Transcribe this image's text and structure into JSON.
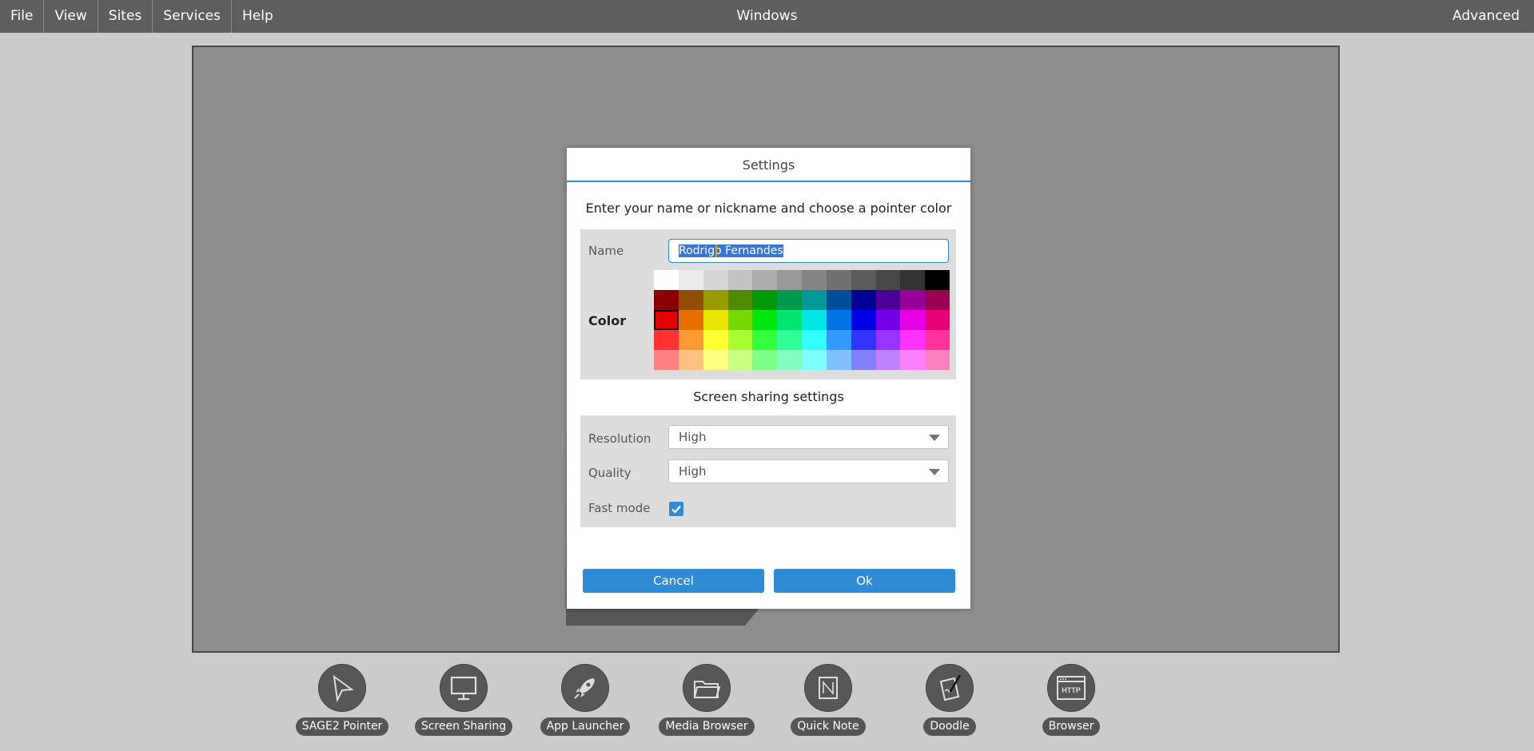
{
  "menubar": {
    "items": [
      "File",
      "View",
      "Sites",
      "Services",
      "Help"
    ],
    "center_title": "Windows",
    "right_item": "Advanced"
  },
  "dialog": {
    "title": "Settings",
    "subtitle": "Enter your name or nickname and choose a pointer color",
    "name_label": "Name",
    "name_value": "Rodrigo Fernandes",
    "color_label": "Color",
    "selected_color": "#e00000",
    "palette": [
      [
        "#ffffff",
        "#ebebeb",
        "#d6d6d6",
        "#c2c2c2",
        "#adadad",
        "#999999",
        "#858585",
        "#707070",
        "#5c5c5c",
        "#474747",
        "#333333",
        "#000000"
      ],
      [
        "#8b0000",
        "#934d0a",
        "#999900",
        "#4d8c00",
        "#00990a",
        "#00994d",
        "#009999",
        "#004d99",
        "#000099",
        "#4d0099",
        "#990099",
        "#990052"
      ],
      [
        "#e00000",
        "#e66f00",
        "#e6e600",
        "#73d900",
        "#00e60f",
        "#00e673",
        "#00e6e6",
        "#0073e6",
        "#0000e6",
        "#7300e6",
        "#e600e6",
        "#e6007a"
      ],
      [
        "#ff3333",
        "#ff9933",
        "#ffff33",
        "#a6ff33",
        "#33ff40",
        "#33ff99",
        "#33ffff",
        "#3399ff",
        "#3333ff",
        "#9933ff",
        "#ff33ff",
        "#ff3399"
      ],
      [
        "#ff8080",
        "#ffc080",
        "#ffff80",
        "#c8ff80",
        "#80ff88",
        "#80ffc0",
        "#80ffff",
        "#80c0ff",
        "#8080ff",
        "#c080ff",
        "#ff80ff",
        "#ff80c0"
      ]
    ],
    "share_title": "Screen sharing settings",
    "resolution_label": "Resolution",
    "resolution_value": "High",
    "quality_label": "Quality",
    "quality_value": "High",
    "fast_mode_label": "Fast mode",
    "fast_mode_checked": true,
    "cancel_label": "Cancel",
    "ok_label": "Ok"
  },
  "dock": [
    {
      "label": "SAGE2 Pointer",
      "icon": "pointer-arrow-icon"
    },
    {
      "label": "Screen Sharing",
      "icon": "monitor-icon"
    },
    {
      "label": "App Launcher",
      "icon": "rocket-icon"
    },
    {
      "label": "Media Browser",
      "icon": "folder-icon"
    },
    {
      "label": "Quick Note",
      "icon": "note-icon"
    },
    {
      "label": "Doodle",
      "icon": "doodle-icon"
    },
    {
      "label": "Browser",
      "icon": "http-browser-icon"
    }
  ],
  "colors": {
    "accent": "#2f8bd3",
    "menubar": "#5e5e5e",
    "background": "#cbcbcb",
    "wall": "#8e8e8e"
  }
}
